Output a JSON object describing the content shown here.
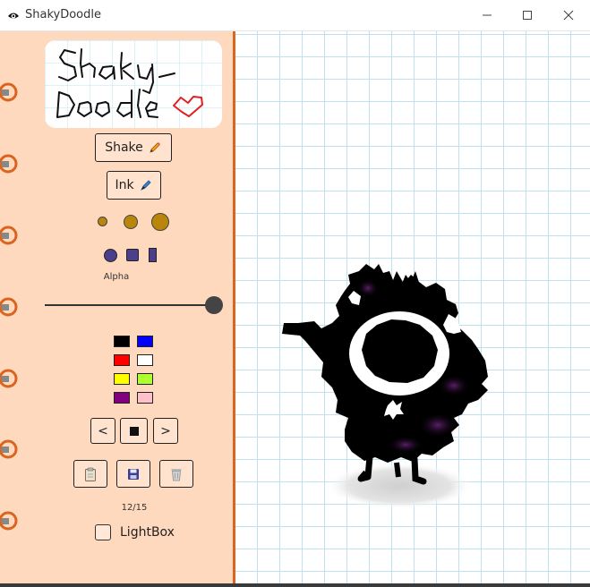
{
  "window": {
    "title": "ShakyDoodle",
    "minimize_label": "minimize",
    "maximize_label": "maximize",
    "close_label": "close"
  },
  "sidebar": {
    "logo_icon": "shakydoodle-logo",
    "shake_button": {
      "label": "Shake",
      "icon": "pencil-icon"
    },
    "ink_button": {
      "label": "Ink",
      "icon": "pen-icon"
    },
    "brush_sizes": [
      "small",
      "medium",
      "large"
    ],
    "brush_shapes": [
      "circle",
      "square",
      "bar"
    ],
    "brush_color": "#b8860b",
    "shape_color": "#4b3f8c",
    "alpha": {
      "label": "Alpha",
      "value": 1.0
    },
    "colors": [
      "#000000",
      "#0000ff",
      "#ff0000",
      "#ffffff",
      "#ffff00",
      "#adff2f",
      "#800080",
      "#ffc0cb"
    ],
    "frame_controls": {
      "prev_label": "<",
      "stop_icon": "stop-icon",
      "next_label": ">"
    },
    "actions": [
      "clipboard-icon",
      "save-icon",
      "trash-icon"
    ],
    "frame_counter": "12/15",
    "lightbox": {
      "label": "LightBox",
      "checked": false
    }
  },
  "canvas": {
    "grid_color": "#bfe1ee",
    "drawing": "shaky-monster-drawing"
  }
}
